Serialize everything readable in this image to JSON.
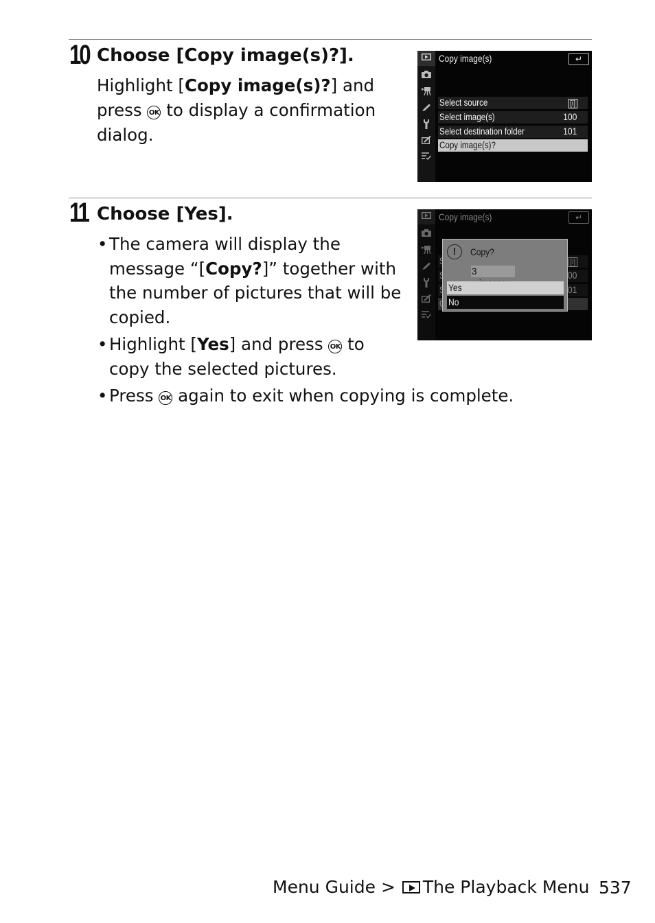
{
  "steps": [
    {
      "number": "10",
      "title": "Choose [Copy image(s)?].",
      "body": {
        "l1_pre": "Highlight [",
        "l1_bold": "Copy image(s)?",
        "l1_post": "] and",
        "l2_pre": "press ",
        "ok": "OK",
        "l2_post": " to display a confirmation",
        "l3": "dialog."
      },
      "screen": {
        "title": "Copy image(s)",
        "back_icon": "↵",
        "sidebar_icons": [
          "playback-icon",
          "camera-icon",
          "movie-icon",
          "pencil-icon",
          "wrench-icon",
          "retouch-icon",
          "my-menu-icon"
        ],
        "rows": [
          {
            "label": "Select source",
            "value": "[i]",
            "selected": false
          },
          {
            "label": "Select image(s)",
            "value": "100",
            "selected": false
          },
          {
            "label": "Select destination folder",
            "value": "101",
            "selected": false
          },
          {
            "label": "Copy image(s)?",
            "value": "",
            "selected": true
          }
        ]
      }
    },
    {
      "number": "11",
      "title": "Choose [Yes].",
      "bullets": [
        {
          "pre": "The camera will display the message “[",
          "bold": "Copy?",
          "post": "]” together with the number of pictures that will be copied."
        },
        {
          "pre": "Highlight [",
          "bold": "Yes",
          "mid": "] and press ",
          "ok": "OK",
          "post": " to copy the selected pictures."
        },
        {
          "pre": "Press ",
          "ok": "OK",
          "post": " again to exit when copying is complete."
        }
      ],
      "screen": {
        "title": "Copy image(s)",
        "dialog": {
          "question": "Copy?",
          "count": "3",
          "count_unit": "images",
          "options": [
            {
              "label": "Yes",
              "highlighted": true
            },
            {
              "label": "No",
              "highlighted": false
            }
          ]
        }
      }
    }
  ],
  "footer": {
    "section": "Menu Guide >",
    "menu": "The Playback Menu",
    "page": "537"
  }
}
